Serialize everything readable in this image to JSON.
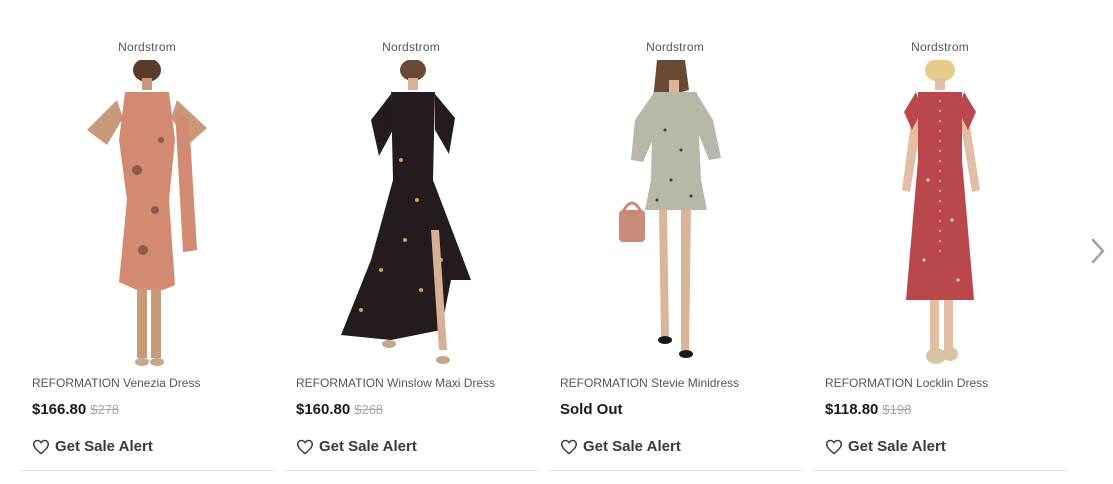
{
  "carousel": {
    "products": [
      {
        "retailer": "Nordstrom",
        "title": "REFORMATION Venezia Dress",
        "price": "$166.80",
        "original_price": "$278",
        "status": "",
        "alert_label": "Get Sale Alert",
        "dress_color": "#d28a72",
        "print_color": "#8b5a48"
      },
      {
        "retailer": "Nordstrom",
        "title": "REFORMATION Winslow Maxi Dress",
        "price": "$160.80",
        "original_price": "$268",
        "status": "",
        "alert_label": "Get Sale Alert",
        "dress_color": "#231b1e",
        "print_color": "#c9a94a"
      },
      {
        "retailer": "Nordstrom",
        "title": "REFORMATION Stevie Minidress",
        "price": "",
        "original_price": "",
        "status": "Sold Out",
        "alert_label": "Get Sale Alert",
        "dress_color": "#b9b6aa",
        "print_color": "#3b3a36"
      },
      {
        "retailer": "Nordstrom",
        "title": "REFORMATION Locklin Dress",
        "price": "$118.80",
        "original_price": "$198",
        "status": "",
        "alert_label": "Get Sale Alert",
        "dress_color": "#b9474c",
        "print_color": "#f0d8d4"
      }
    ],
    "next_icon": "chevron-right-icon"
  },
  "colors": {
    "divider": "#dcdcdc",
    "strike_price": "#a8a8a8",
    "text_dark": "#1a1a1a",
    "text_muted": "#555555"
  }
}
